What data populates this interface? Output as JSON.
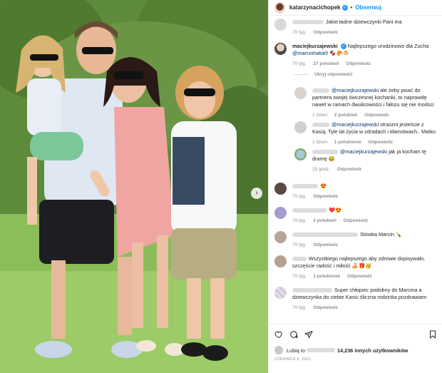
{
  "post": {
    "author": "katarzynacichopek",
    "follow_label": "Obserwuj",
    "dot": "•"
  },
  "comments": [
    {
      "text": "Jakie ładne dziewczynki Pani ma",
      "time": "70 tyg.",
      "reply": "Odpowiedz"
    },
    {
      "user": "maciejkurzajewski",
      "text": "Najlepszego urodzinowo dla Zucha",
      "mention": "@marcinhakiel",
      "tail": "! 🍫🥐🍮",
      "time": "70 tyg.",
      "likes": "27 polubień",
      "reply": "Odpowiedz",
      "hide": "Ukryj odpowiedzi"
    },
    {
      "mention": "@maciejkurzajewski",
      "text": "ale żeby pisać do partnera swojej ówczesnej kochanki, to naprawdę nawet w ramach dwulicowości i fałszu się nie modsci",
      "time": "1 dzień",
      "likes": "2 polubień",
      "reply": "Odpowiedz"
    },
    {
      "mention": "@maciejkurzajewski",
      "text": "straszni jesteście z Kasią. Tyle lat życia w zdradach i kłamstwach.. Matko",
      "time": "1 dzień",
      "likes": "1 polubienie",
      "reply": "Odpowiedz"
    },
    {
      "mention": "@maciejkurzajewski",
      "text": "jak ja kocham tę dramę 😂",
      "time": "15 godz.",
      "reply": "Odpowiedz"
    },
    {
      "text": "😍",
      "time": "70 tyg.",
      "reply": "Odpowiedz"
    },
    {
      "text": "❤️😍",
      "time": "70 tyg.",
      "likes": "2 polubień",
      "reply": "Odpowiedz"
    },
    {
      "text": "Stówka Marcin 🍾",
      "time": "70 tyg.",
      "reply": "Odpowiedz"
    },
    {
      "text": "Wszystkiego najlepszego aby zdrowie dopisywało, szczęście radość i miłość 🍰🎁🥳",
      "time": "70 tyg.",
      "likes": "1 polubienie",
      "reply": "Odpowiedz"
    },
    {
      "text": "Super chłopiec podobny do Marcina a dziewczynka do ciebie Kasiu śliczna rodzinka pozdrawiam",
      "time": "70 tyg.",
      "reply": "Odpowiedz"
    }
  ],
  "footer": {
    "likes_prefix": "Lubią to",
    "likes_count": "14,236 innych użytkowników",
    "date": "CZERWCA 6, 2021"
  },
  "icons": {
    "like": "heart-icon",
    "comment": "comment-icon",
    "share": "send-icon",
    "save": "bookmark-icon",
    "next": "chevron-right-icon"
  },
  "colors": {
    "link": "#0095f6",
    "mention": "#00376b",
    "muted": "#8e8e8e"
  }
}
